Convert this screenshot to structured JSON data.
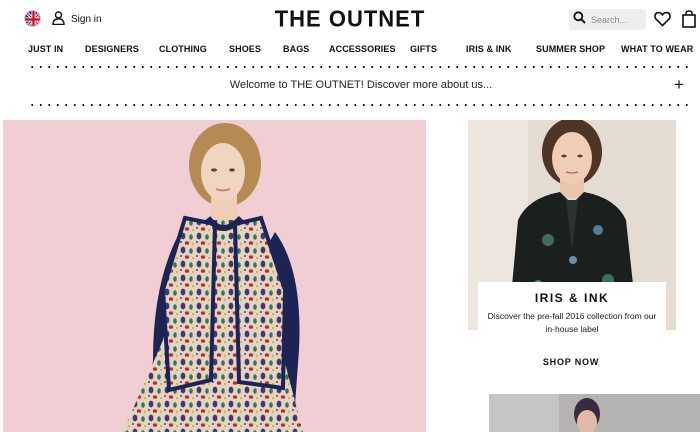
{
  "header": {
    "region_icon": "uk-flag-icon",
    "signin_icon": "user-icon",
    "signin_label": "Sign in",
    "logo": "THE OUTNET",
    "search_icon": "search-icon",
    "search_placeholder": "Search...",
    "wishlist_icon": "heart-icon",
    "bag_icon": "shopping-bag-icon"
  },
  "nav": {
    "items": [
      {
        "label": "JUST IN"
      },
      {
        "label": "DESIGNERS"
      },
      {
        "label": "CLOTHING"
      },
      {
        "label": "SHOES"
      },
      {
        "label": "BAGS"
      },
      {
        "label": "ACCESSORIES"
      },
      {
        "label": "GIFTS"
      },
      {
        "label": "IRIS & INK"
      },
      {
        "label": "SUMMER SHOP"
      },
      {
        "label": "WHAT TO WEAR"
      }
    ]
  },
  "welcome": {
    "text": "Welcome to THE OUTNET! Discover more about us...",
    "expand_icon": "plus-icon"
  },
  "hero": {
    "image": "model-in-embellished-cardigan-photo"
  },
  "promo": {
    "image": "model-in-floral-blouse-photo",
    "title": "IRIS & INK",
    "description": "Discover the pre-fall 2016 collection from our in-house label",
    "button_label": "SHOP NOW"
  },
  "next_promo": {
    "image": "model-portrait-photo"
  },
  "colors": {
    "hero_bg": "#f1ced3",
    "promo_bg": "#e5ddd5",
    "text": "#111111"
  }
}
